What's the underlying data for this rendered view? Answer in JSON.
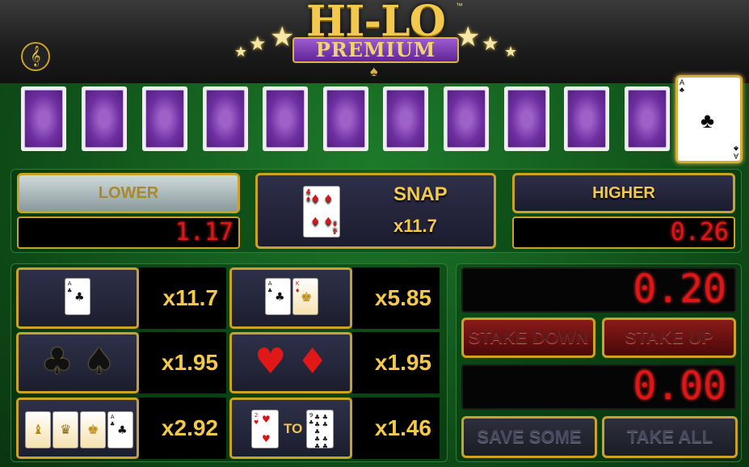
{
  "logo": {
    "title": "HI-LO",
    "tm": "™",
    "subtitle": "PREMIUM"
  },
  "music_button": {
    "icon": "music-note-icon",
    "glyph": "𝄞"
  },
  "current_card": {
    "rank": "A",
    "suit": "♣",
    "color": "black"
  },
  "face_down_count": 11,
  "lower": {
    "label": "LOWER",
    "payout": "1.17"
  },
  "snap": {
    "label": "SNAP",
    "multiplier": "x11.7",
    "card_rank": "4",
    "card_suit": "♦"
  },
  "higher": {
    "label": "HIGHER",
    "payout": "0.26"
  },
  "side_bets": [
    {
      "id": "ace",
      "multiplier": "x11.7"
    },
    {
      "id": "ace-king",
      "multiplier": "x5.85"
    },
    {
      "id": "black-suits",
      "multiplier": "x1.95"
    },
    {
      "id": "red-suits",
      "multiplier": "x1.95"
    },
    {
      "id": "court-cards",
      "multiplier": "x2.92"
    },
    {
      "id": "two-to-nine",
      "multiplier": "x1.46",
      "to_label": "TO"
    }
  ],
  "stake": {
    "value": "0.20",
    "down_label": "STAKE DOWN",
    "up_label": "STAKE UP"
  },
  "win": {
    "value": "0.00",
    "save_label": "SAVE SOME",
    "take_label": "TAKE ALL"
  },
  "colors": {
    "gold": "#c9a227",
    "felt": "#1d7a2a",
    "led_red": "#e01515",
    "card_back": "#6d2fa0"
  }
}
